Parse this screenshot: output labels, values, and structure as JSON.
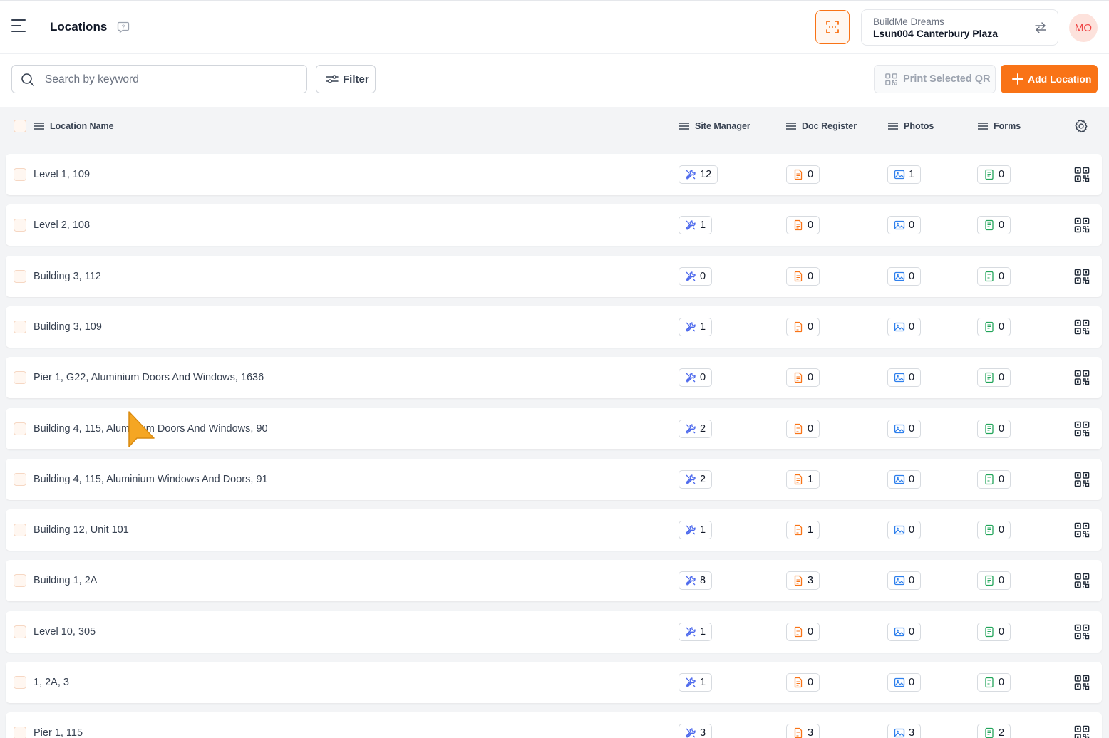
{
  "header": {
    "title": "Locations",
    "company": "BuildMe Dreams",
    "project": "Lsun004 Canterbury Plaza",
    "avatar_initials": "MO",
    "accent_color": "#f97316"
  },
  "toolbar": {
    "search_placeholder": "Search by keyword",
    "filter_label": "Filter",
    "print_label": "Print Selected QR",
    "add_label": "Add Location"
  },
  "table": {
    "columns": {
      "name": "Location Name",
      "site_manager": "Site Manager",
      "doc_register": "Doc Register",
      "photos": "Photos",
      "forms": "Forms"
    },
    "rows": [
      {
        "name": "Level 1, 109",
        "site": "12",
        "doc": "0",
        "photos": "1",
        "forms": "0"
      },
      {
        "name": "Level 2, 108",
        "site": "1",
        "doc": "0",
        "photos": "0",
        "forms": "0"
      },
      {
        "name": "Building 3, 112",
        "site": "0",
        "doc": "0",
        "photos": "0",
        "forms": "0"
      },
      {
        "name": "Building 3, 109",
        "site": "1",
        "doc": "0",
        "photos": "0",
        "forms": "0"
      },
      {
        "name": "Pier 1, G22, Aluminium Doors And Windows, 1636",
        "site": "0",
        "doc": "0",
        "photos": "0",
        "forms": "0"
      },
      {
        "name": "Building 4, 115, Aluminium Doors And Windows, 90",
        "site": "2",
        "doc": "0",
        "photos": "0",
        "forms": "0"
      },
      {
        "name": "Building 4, 115, Aluminium Windows And Doors, 91",
        "site": "2",
        "doc": "1",
        "photos": "0",
        "forms": "0"
      },
      {
        "name": "Building 12, Unit 101",
        "site": "1",
        "doc": "1",
        "photos": "0",
        "forms": "0"
      },
      {
        "name": "Building 1, 2A",
        "site": "8",
        "doc": "3",
        "photos": "0",
        "forms": "0"
      },
      {
        "name": "Level 10, 305",
        "site": "1",
        "doc": "0",
        "photos": "0",
        "forms": "0"
      },
      {
        "name": "1, 2A, 3",
        "site": "1",
        "doc": "0",
        "photos": "0",
        "forms": "0"
      },
      {
        "name": "Pier 1, 115",
        "site": "3",
        "doc": "3",
        "photos": "3",
        "forms": "2"
      }
    ]
  }
}
